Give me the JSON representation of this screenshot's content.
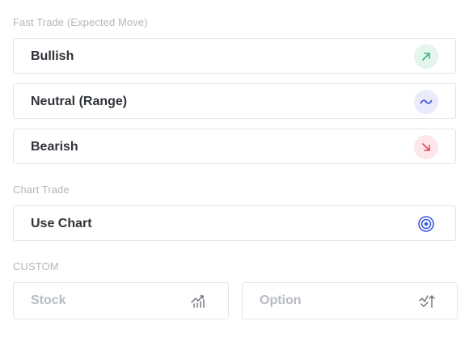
{
  "fast_trade": {
    "title": "Fast Trade (Expected Move)",
    "options": [
      {
        "label": "Bullish",
        "icon": "arrow-up-right-icon",
        "color": "#3fb37f"
      },
      {
        "label": "Neutral (Range)",
        "icon": "tilde-icon",
        "color": "#4150d8"
      },
      {
        "label": "Bearish",
        "icon": "arrow-down-right-icon",
        "color": "#e0455a"
      }
    ]
  },
  "chart_trade": {
    "title": "Chart Trade",
    "option": {
      "label": "Use Chart",
      "icon": "target-icon",
      "color": "#3b5bdb"
    }
  },
  "custom": {
    "title": "CUSTOM",
    "options": [
      {
        "label": "Stock",
        "icon": "stock-chart-icon"
      },
      {
        "label": "Option",
        "icon": "option-chart-icon"
      }
    ]
  }
}
